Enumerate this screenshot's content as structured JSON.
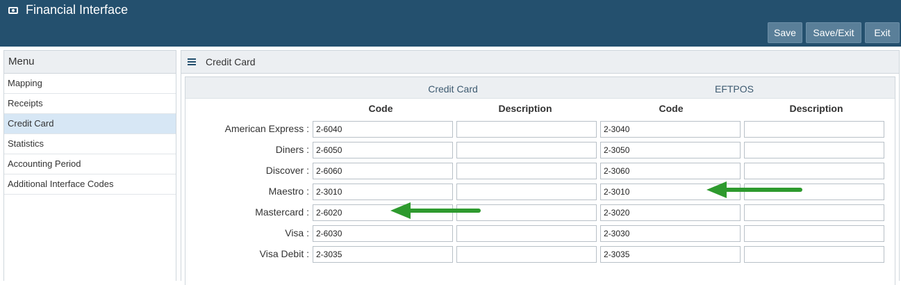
{
  "window": {
    "title": "Financial Interface",
    "icon": "money-icon"
  },
  "toolbar": {
    "save": "Save",
    "save_exit": "Save/Exit",
    "exit": "Exit"
  },
  "sidebar": {
    "header": "Menu",
    "items": [
      {
        "label": "Mapping",
        "active": false
      },
      {
        "label": "Receipts",
        "active": false
      },
      {
        "label": "Credit Card",
        "active": true
      },
      {
        "label": "Statistics",
        "active": false
      },
      {
        "label": "Accounting Period",
        "active": false
      },
      {
        "label": "Additional Interface Codes",
        "active": false
      }
    ]
  },
  "main": {
    "title": "Credit Card",
    "groups": {
      "credit_card": "Credit Card",
      "eftpos": "EFTPOS"
    },
    "columns": {
      "code": "Code",
      "description": "Description"
    },
    "rows": [
      {
        "label": "American Express :",
        "cc_code": "2-6040",
        "cc_desc": "",
        "eft_code": "2-3040",
        "eft_desc": ""
      },
      {
        "label": "Diners :",
        "cc_code": "2-6050",
        "cc_desc": "",
        "eft_code": "2-3050",
        "eft_desc": ""
      },
      {
        "label": "Discover :",
        "cc_code": "2-6060",
        "cc_desc": "",
        "eft_code": "2-3060",
        "eft_desc": ""
      },
      {
        "label": "Maestro :",
        "cc_code": "2-3010",
        "cc_desc": "",
        "eft_code": "2-3010",
        "eft_desc": ""
      },
      {
        "label": "Mastercard :",
        "cc_code": "2-6020",
        "cc_desc": "",
        "eft_code": "2-3020",
        "eft_desc": ""
      },
      {
        "label": "Visa :",
        "cc_code": "2-6030",
        "cc_desc": "",
        "eft_code": "2-3030",
        "eft_desc": ""
      },
      {
        "label": "Visa Debit :",
        "cc_code": "2-3035",
        "cc_desc": "",
        "eft_code": "2-3035",
        "eft_desc": ""
      }
    ]
  },
  "annotations": {
    "arrow_color": "#2e9a2e"
  },
  "colors": {
    "header_bg": "#24506e",
    "button_bg": "#5a7f99",
    "active_item_bg": "#d7e7f5"
  }
}
